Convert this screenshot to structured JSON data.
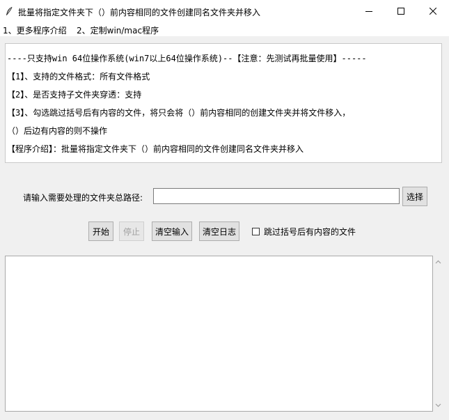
{
  "window": {
    "title": "批量将指定文件夹下（）前内容相同的文件创建同名文件夹并移入",
    "app_icon": "feather-icon",
    "controls": [
      "minimize-icon",
      "maximize-icon",
      "close-icon"
    ]
  },
  "menu": {
    "items": [
      {
        "label": "1、更多程序介绍"
      },
      {
        "label": "2、定制win/mac程序"
      }
    ]
  },
  "info": {
    "lines": [
      "----只支持win 64位操作系统(win7以上64位操作系统)--【注意：先测试再批量使用】-----",
      "【1】、支持的文件格式：所有文件格式",
      "【2】、是否支持子文件夹穿透：支持",
      "【3】、勾选跳过括号后有内容的文件，将只会将（）前内容相同的创建文件夹并将文件移入，",
      "（）后边有内容的则不操作",
      "【程序介绍】：批量将指定文件夹下（）前内容相同的文件创建同名文件夹并移入"
    ]
  },
  "path": {
    "label": "请输入需要处理的文件夹总路径:",
    "value": "",
    "browse_label": "选择"
  },
  "actions": {
    "start_label": "开始",
    "stop_label": "停止",
    "clear_input_label": "清空输入",
    "clear_log_label": "清空日志",
    "skip_checkbox_label": "跳过括号后有内容的文件",
    "skip_checked": false
  },
  "log": {
    "content": ""
  }
}
